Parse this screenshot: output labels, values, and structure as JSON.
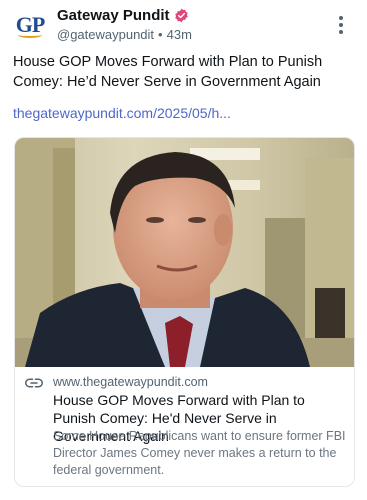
{
  "author": {
    "avatar_text": "GP",
    "display_name": "Gateway Pundit",
    "handle": "@gatewaypundit",
    "separator": "•",
    "time": "43m",
    "verified_color": "#e0457b"
  },
  "post": {
    "text": "House GOP Moves Forward with Plan to Punish Comey: He’d Never Serve in Government Again",
    "link_text": "thegatewaypundit.com/2025/05/h...",
    "link_color": "#4f67c9"
  },
  "card": {
    "domain": "www.thegatewaypundit.com",
    "title": "House GOP Moves Forward with Plan to Punish Comey: He'd Never Serve in Government Again",
    "description": "Some House Republicans want to ensure former FBI Director James Comey never makes a return to the federal government.",
    "icons": {
      "link": "link-icon",
      "more": "more-vertical-icon",
      "verified": "verified-badge-icon"
    }
  }
}
